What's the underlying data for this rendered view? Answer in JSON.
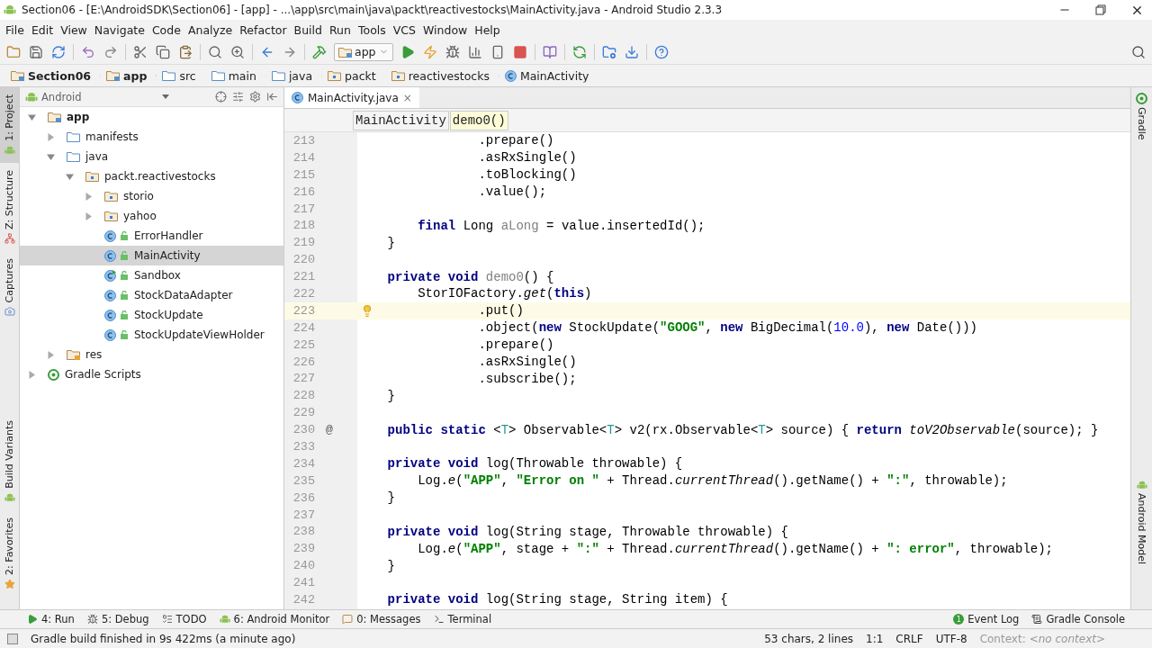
{
  "window": {
    "title": "Section06 - [E:\\AndroidSDK\\Section06] - [app] - ...\\app\\src\\main\\java\\packt\\reactivestocks\\MainActivity.java - Android Studio 2.3.3"
  },
  "menu": [
    "File",
    "Edit",
    "View",
    "Navigate",
    "Code",
    "Analyze",
    "Refactor",
    "Build",
    "Run",
    "Tools",
    "VCS",
    "Window",
    "Help"
  ],
  "toolbar": {
    "run_config": "app"
  },
  "navigation_bar": [
    {
      "label": "Section06",
      "kind": "module"
    },
    {
      "label": "app",
      "kind": "module"
    },
    {
      "label": "src",
      "kind": "folder"
    },
    {
      "label": "main",
      "kind": "folder"
    },
    {
      "label": "java",
      "kind": "source"
    },
    {
      "label": "packt",
      "kind": "package"
    },
    {
      "label": "reactivestocks",
      "kind": "package"
    },
    {
      "label": "MainActivity",
      "kind": "class"
    }
  ],
  "left_stripe": [
    {
      "label": "1: Project",
      "selected": true
    },
    {
      "label": "Z: Structure",
      "selected": false
    },
    {
      "label": "Captures",
      "selected": false
    },
    {
      "label": "Build Variants",
      "selected": false
    },
    {
      "label": "2: Favorites",
      "selected": false
    }
  ],
  "project": {
    "view": "Android",
    "tree": [
      {
        "label": "app",
        "kind": "module",
        "expanded": true,
        "selected": false,
        "children": [
          {
            "label": "manifests",
            "kind": "folder",
            "expanded": false,
            "selected": false
          },
          {
            "label": "java",
            "kind": "folder",
            "expanded": true,
            "selected": false,
            "children": [
              {
                "label": "packt.reactivestocks",
                "kind": "package",
                "expanded": true,
                "selected": false,
                "children": [
                  {
                    "label": "storio",
                    "kind": "package",
                    "expanded": false,
                    "selected": false
                  },
                  {
                    "label": "yahoo",
                    "kind": "package",
                    "expanded": false,
                    "selected": false
                  },
                  {
                    "label": "ErrorHandler",
                    "kind": "class",
                    "selected": false
                  },
                  {
                    "label": "MainActivity",
                    "kind": "class",
                    "selected": true
                  },
                  {
                    "label": "Sandbox",
                    "kind": "runnable",
                    "selected": false
                  },
                  {
                    "label": "StockDataAdapter",
                    "kind": "class",
                    "selected": false
                  },
                  {
                    "label": "StockUpdate",
                    "kind": "class",
                    "selected": false
                  },
                  {
                    "label": "StockUpdateViewHolder",
                    "kind": "class",
                    "selected": false
                  }
                ]
              }
            ]
          },
          {
            "label": "res",
            "kind": "res",
            "expanded": false,
            "selected": false
          }
        ]
      },
      {
        "label": "Gradle Scripts",
        "kind": "gradle",
        "expanded": false,
        "selected": false
      }
    ]
  },
  "editor": {
    "tabs": [
      {
        "label": "MainActivity.java",
        "close": "×",
        "selected": true
      }
    ],
    "breadcrumbs": [
      {
        "label": "MainActivity",
        "selected": false
      },
      {
        "label": "demo0()",
        "selected": true
      }
    ],
    "lines": [
      {
        "number": "213",
        "current": false,
        "segments": [
          {
            "text": "                .prepare()",
            "kind": "plain"
          }
        ]
      },
      {
        "number": "214",
        "current": false,
        "segments": [
          {
            "text": "                .asRxSingle()",
            "kind": "plain"
          }
        ]
      },
      {
        "number": "215",
        "current": false,
        "segments": [
          {
            "text": "                .toBlocking()",
            "kind": "plain"
          }
        ]
      },
      {
        "number": "216",
        "current": false,
        "segments": [
          {
            "text": "                .value();",
            "kind": "plain"
          }
        ]
      },
      {
        "number": "217",
        "current": false
      },
      {
        "number": "218",
        "current": false,
        "segments": [
          {
            "text": "        final",
            "kind": "keyword"
          },
          {
            "text": " Long ",
            "kind": "plain"
          },
          {
            "text": "aLong",
            "kind": "unused"
          },
          {
            "text": " = value.insertedId();",
            "kind": "plain"
          }
        ]
      },
      {
        "number": "219",
        "current": false,
        "segments": [
          {
            "text": "    }",
            "kind": "plain"
          }
        ]
      },
      {
        "number": "220",
        "current": false
      },
      {
        "number": "221",
        "current": false,
        "segments": [
          {
            "text": "    private void ",
            "kind": "keyword"
          },
          {
            "text": "demo0",
            "kind": "unused"
          },
          {
            "text": "() {",
            "kind": "plain"
          }
        ]
      },
      {
        "number": "222",
        "current": false,
        "segments": [
          {
            "text": "        StorIOFactory.",
            "kind": "plain"
          },
          {
            "text": "get",
            "kind": "static"
          },
          {
            "text": "(",
            "kind": "plain"
          },
          {
            "text": "this",
            "kind": "keyword"
          },
          {
            "text": ")",
            "kind": "plain"
          }
        ]
      },
      {
        "number": "223",
        "current": true,
        "segments": [
          {
            "text": "                .put()",
            "kind": "plain"
          }
        ]
      },
      {
        "number": "224",
        "current": false,
        "segments": [
          {
            "text": "                .object(",
            "kind": "plain"
          },
          {
            "text": "new",
            "kind": "keyword"
          },
          {
            "text": " StockUpdate(",
            "kind": "plain"
          },
          {
            "text": "\"GOOG\"",
            "kind": "string"
          },
          {
            "text": ", ",
            "kind": "plain"
          },
          {
            "text": "new",
            "kind": "keyword"
          },
          {
            "text": " BigDecimal(",
            "kind": "plain"
          },
          {
            "text": "10.0",
            "kind": "number"
          },
          {
            "text": "), ",
            "kind": "plain"
          },
          {
            "text": "new",
            "kind": "keyword"
          },
          {
            "text": " Date()))",
            "kind": "plain"
          }
        ]
      },
      {
        "number": "225",
        "current": false,
        "segments": [
          {
            "text": "                .prepare()",
            "kind": "plain"
          }
        ]
      },
      {
        "number": "226",
        "current": false,
        "segments": [
          {
            "text": "                .asRxSingle()",
            "kind": "plain"
          }
        ]
      },
      {
        "number": "227",
        "current": false,
        "segments": [
          {
            "text": "                .subscribe();",
            "kind": "plain"
          }
        ]
      },
      {
        "number": "228",
        "current": false,
        "segments": [
          {
            "text": "    }",
            "kind": "plain"
          }
        ]
      },
      {
        "number": "229",
        "current": false
      },
      {
        "number": "230",
        "current": false,
        "gutter_mark": "@",
        "segments": [
          {
            "text": "    public static ",
            "kind": "keyword"
          },
          {
            "text": "<",
            "kind": "plain"
          },
          {
            "text": "T",
            "kind": "typeparam"
          },
          {
            "text": "> Observable<",
            "kind": "plain"
          },
          {
            "text": "T",
            "kind": "typeparam"
          },
          {
            "text": "> v2(rx.Observable<",
            "kind": "plain"
          },
          {
            "text": "T",
            "kind": "typeparam"
          },
          {
            "text": "> source) { ",
            "kind": "plain"
          },
          {
            "text": "return ",
            "kind": "keyword"
          },
          {
            "text": "toV2Observable",
            "kind": "static"
          },
          {
            "text": "(source); }",
            "kind": "plain"
          }
        ]
      },
      {
        "number": "233",
        "current": false
      },
      {
        "number": "234",
        "current": false,
        "segments": [
          {
            "text": "    private void ",
            "kind": "keyword"
          },
          {
            "text": "log(Throwable throwable) {",
            "kind": "plain"
          }
        ]
      },
      {
        "number": "235",
        "current": false,
        "segments": [
          {
            "text": "        Log.",
            "kind": "plain"
          },
          {
            "text": "e",
            "kind": "static"
          },
          {
            "text": "(",
            "kind": "plain"
          },
          {
            "text": "\"APP\"",
            "kind": "string"
          },
          {
            "text": ", ",
            "kind": "plain"
          },
          {
            "text": "\"Error on \"",
            "kind": "string"
          },
          {
            "text": " + Thread.",
            "kind": "plain"
          },
          {
            "text": "currentThread",
            "kind": "static"
          },
          {
            "text": "().getName() + ",
            "kind": "plain"
          },
          {
            "text": "\":\"",
            "kind": "string"
          },
          {
            "text": ", throwable);",
            "kind": "plain"
          }
        ]
      },
      {
        "number": "236",
        "current": false,
        "segments": [
          {
            "text": "    }",
            "kind": "plain"
          }
        ]
      },
      {
        "number": "237",
        "current": false
      },
      {
        "number": "238",
        "current": false,
        "segments": [
          {
            "text": "    private void ",
            "kind": "keyword"
          },
          {
            "text": "log(String stage, Throwable throwable) {",
            "kind": "plain"
          }
        ]
      },
      {
        "number": "239",
        "current": false,
        "segments": [
          {
            "text": "        Log.",
            "kind": "plain"
          },
          {
            "text": "e",
            "kind": "static"
          },
          {
            "text": "(",
            "kind": "plain"
          },
          {
            "text": "\"APP\"",
            "kind": "string"
          },
          {
            "text": ", stage + ",
            "kind": "plain"
          },
          {
            "text": "\":\"",
            "kind": "string"
          },
          {
            "text": " + Thread.",
            "kind": "plain"
          },
          {
            "text": "currentThread",
            "kind": "static"
          },
          {
            "text": "().getName() + ",
            "kind": "plain"
          },
          {
            "text": "\": error\"",
            "kind": "string"
          },
          {
            "text": ", throwable);",
            "kind": "plain"
          }
        ]
      },
      {
        "number": "240",
        "current": false,
        "segments": [
          {
            "text": "    }",
            "kind": "plain"
          }
        ]
      },
      {
        "number": "241",
        "current": false
      },
      {
        "number": "242",
        "current": false,
        "segments": [
          {
            "text": "    private void ",
            "kind": "keyword"
          },
          {
            "text": "log(String stage, String item) {",
            "kind": "plain"
          }
        ]
      }
    ]
  },
  "right_stripe": [
    "Gradle",
    "Android Model"
  ],
  "tool_windows": {
    "left": [
      {
        "label": "4: Run",
        "kind": "run"
      },
      {
        "label": "5: Debug",
        "kind": "debug"
      },
      {
        "label": "TODO",
        "kind": "todo"
      },
      {
        "label": "6: Android Monitor",
        "kind": "android"
      },
      {
        "label": "0: Messages",
        "kind": "messages"
      },
      {
        "label": "Terminal",
        "kind": "terminal"
      }
    ],
    "right": [
      {
        "label": "Event Log",
        "kind": "log",
        "badge": "1"
      },
      {
        "label": "Gradle Console",
        "kind": "console"
      }
    ]
  },
  "status_bar": {
    "message": "Gradle build finished in 9s 422ms (a minute ago)",
    "selection": "53 chars, 2 lines",
    "position": "1:1",
    "line_separator": "CRLF",
    "encoding": "UTF-8",
    "context_label": "Context:",
    "context": "<no context>"
  }
}
